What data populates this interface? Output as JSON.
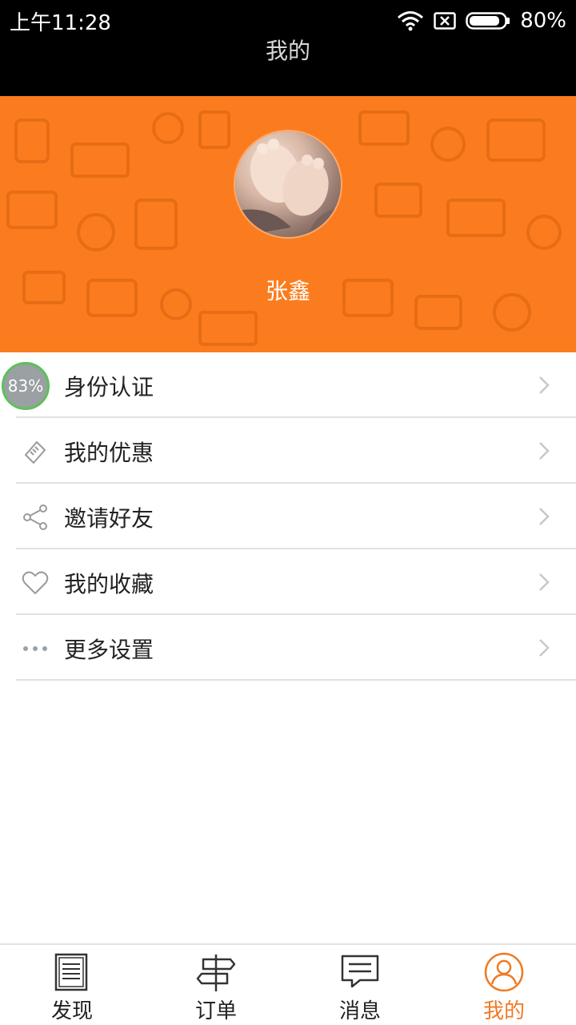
{
  "status_bar": {
    "time": "上午11:28",
    "battery": "80%",
    "wifi_icon": "wifi-icon",
    "sim_icon": "no-sim-icon",
    "battery_icon": "battery-icon"
  },
  "header": {
    "title": "我的"
  },
  "profile": {
    "name": "张鑫",
    "avatar_icon": "avatar-photo",
    "banner_color": "#fb7c1e"
  },
  "floating_badge": {
    "text": "83%"
  },
  "menu": {
    "items": [
      {
        "label": "身份认证",
        "icon": "id-card-icon"
      },
      {
        "label": "我的优惠",
        "icon": "coupon-icon"
      },
      {
        "label": "邀请好友",
        "icon": "share-icon"
      },
      {
        "label": "我的收藏",
        "icon": "heart-icon"
      },
      {
        "label": "更多设置",
        "icon": "more-icon"
      }
    ]
  },
  "bottom_nav": {
    "items": [
      {
        "label": "发现",
        "icon": "discover-icon"
      },
      {
        "label": "订单",
        "icon": "signpost-icon"
      },
      {
        "label": "消息",
        "icon": "message-icon"
      },
      {
        "label": "我的",
        "icon": "user-icon"
      }
    ],
    "active_color": "#f07a23"
  }
}
